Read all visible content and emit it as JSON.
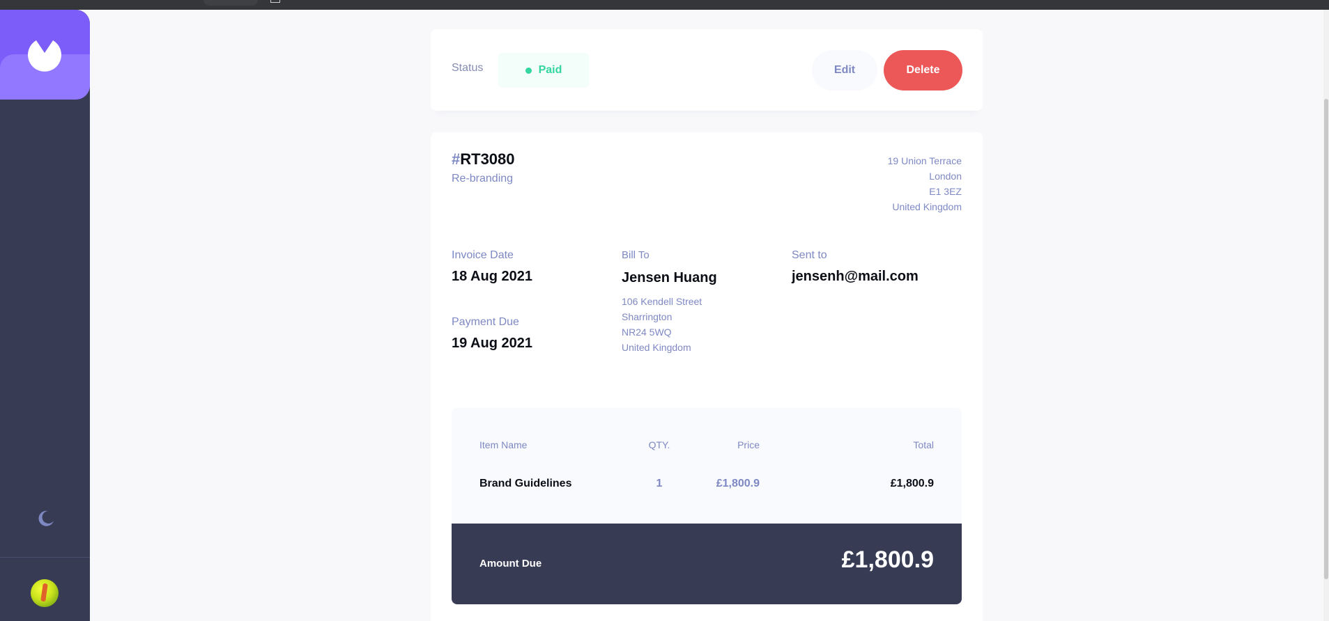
{
  "sidebar": {
    "logo_icon": "brand-logo-icon",
    "theme_toggle_icon": "moon-icon",
    "avatar_icon": "user-avatar",
    "colors": {
      "background": "#373b53",
      "logo": "#7c5dfa",
      "logo_lower": "#9277ff",
      "moon": "#7e88c3"
    }
  },
  "status_bar": {
    "label": "Status",
    "status": "Paid",
    "status_color": "#33d69f",
    "edit_label": "Edit",
    "delete_label": "Delete"
  },
  "invoice": {
    "id_hash": "#",
    "id": "RT3080",
    "description": "Re-branding",
    "sender_address": {
      "street": "19 Union Terrace",
      "city": "London",
      "post_code": "E1 3EZ",
      "country": "United Kingdom"
    },
    "invoice_date_label": "Invoice Date",
    "invoice_date": "18 Aug 2021",
    "payment_due_label": "Payment Due",
    "payment_due": "19 Aug 2021",
    "bill_to_label": "Bill To",
    "client_name": "Jensen Huang",
    "client_address": {
      "street": "106 Kendell Street",
      "city": "Sharrington",
      "post_code": "NR24 5WQ",
      "country": "United Kingdom"
    },
    "sent_to_label": "Sent to",
    "client_email": "jensenh@mail.com"
  },
  "items": {
    "headers": {
      "name": "Item Name",
      "qty": "QTY.",
      "price": "Price",
      "total": "Total"
    },
    "rows": [
      {
        "name": "Brand Guidelines",
        "qty": "1",
        "price": "£1,800.9",
        "total": "£1,800.9"
      }
    ],
    "amount_due_label": "Amount Due",
    "amount_due": "£1,800.9"
  },
  "colors": {
    "accent": "#7c5dfa",
    "delete": "#ec5757",
    "paid": "#33d69f",
    "dark": "#373b53",
    "muted": "#7e88c3"
  }
}
